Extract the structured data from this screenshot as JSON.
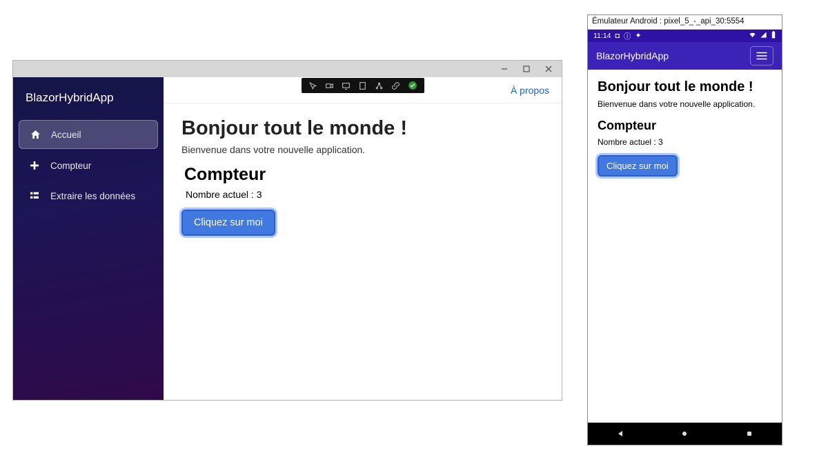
{
  "desktop": {
    "brand": "BlazorHybridApp",
    "sidebar": {
      "items": [
        {
          "label": "Accueil",
          "icon": "home-icon",
          "active": true
        },
        {
          "label": "Compteur",
          "icon": "plus-icon",
          "active": false
        },
        {
          "label": "Extraire les données",
          "icon": "list-icon",
          "active": false
        }
      ]
    },
    "topbar": {
      "about_label": "À propos"
    },
    "page": {
      "heading": "Bonjour tout le monde !",
      "welcome": "Bienvenue dans votre nouvelle application.",
      "counter_heading": "Compteur",
      "count_label": "Nombre actuel : 3",
      "button_label": "Cliquez sur moi"
    }
  },
  "emulator": {
    "window_title": "Émulateur Android : pixel_5_-_api_30:5554",
    "status_time": "11:14",
    "navbar_brand": "BlazorHybridApp",
    "page": {
      "heading": "Bonjour tout le monde !",
      "welcome": "Bienvenue dans votre nouvelle application.",
      "counter_heading": "Compteur",
      "count_label": "Nombre actuel : 3",
      "button_label": "Cliquez sur moi"
    }
  }
}
